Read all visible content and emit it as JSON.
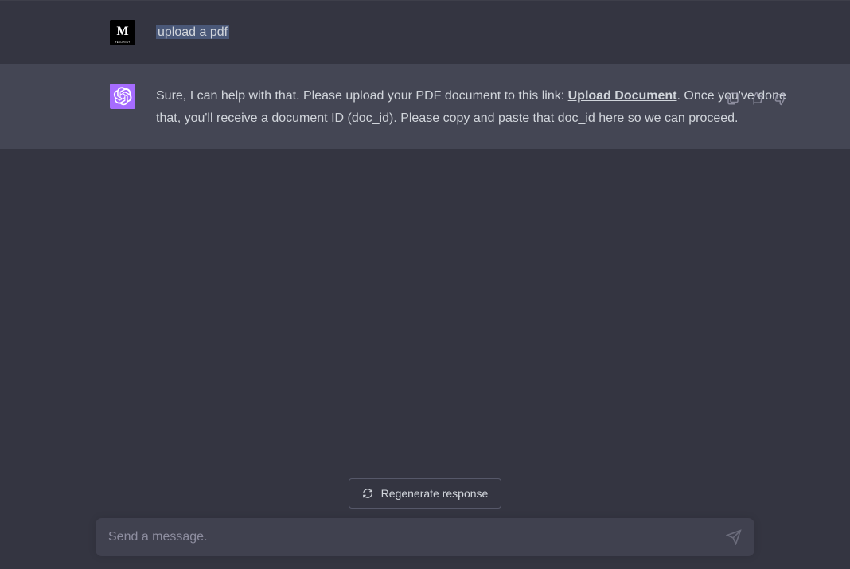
{
  "user_message": {
    "text": "upload a pdf"
  },
  "assistant_message": {
    "text_before_link": "Sure, I can help with that. Please upload your PDF document to this link: ",
    "link_text": "Upload Document",
    "text_after_link": ". Once you've done that, you'll receive a document ID (doc_id). Please copy and paste that doc_id here so we can proceed."
  },
  "controls": {
    "regenerate_label": "Regenerate response",
    "input_placeholder": "Send a message."
  }
}
